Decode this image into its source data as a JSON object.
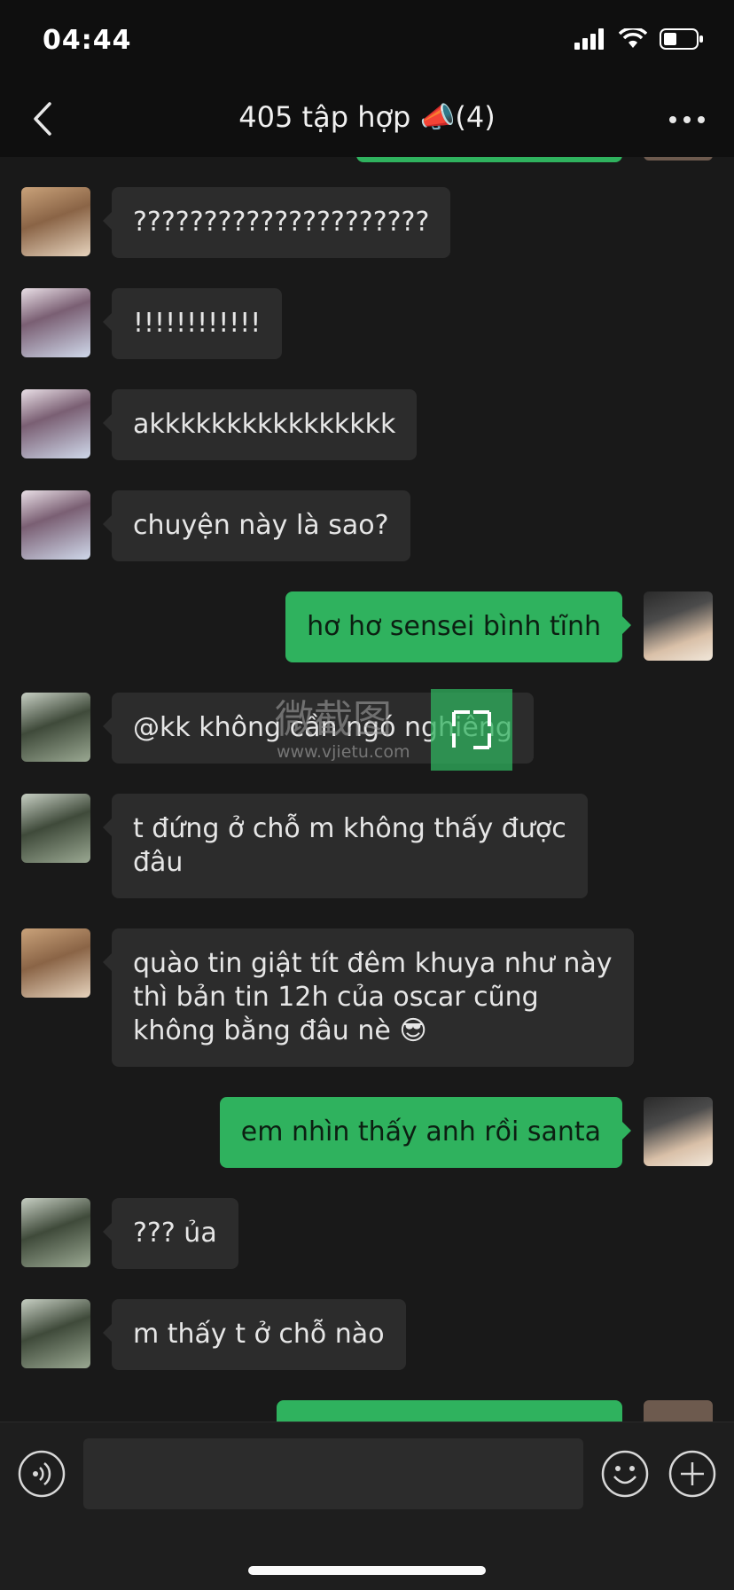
{
  "status": {
    "time": "04:44"
  },
  "header": {
    "title": "405 tập hợp 📣(4)"
  },
  "messages": [
    {
      "side": "in",
      "avatar": "avatar-blond",
      "text": "?????????????????????"
    },
    {
      "side": "in",
      "avatar": "avatar-white-shirt",
      "text": "!!!!!!!!!!!!"
    },
    {
      "side": "in",
      "avatar": "avatar-white-shirt",
      "text": "akkkkkkkkkkkkkkkk"
    },
    {
      "side": "in",
      "avatar": "avatar-white-shirt",
      "text": "chuyện này là sao?"
    },
    {
      "side": "out",
      "avatar": "avatar-beanie",
      "text": "hơ hơ sensei bình tĩnh"
    },
    {
      "side": "in",
      "avatar": "avatar-camo",
      "text": "@kk không cần ngó nghiêng"
    },
    {
      "side": "in",
      "avatar": "avatar-camo",
      "text": "t đứng ở chỗ m không thấy được\nđâu"
    },
    {
      "side": "in",
      "avatar": "avatar-blond",
      "text": "quào tin giật tít đêm khuya như này\nthì bản tin 12h của oscar cũng\nkhông bằng đâu nè 😎"
    },
    {
      "side": "out",
      "avatar": "avatar-beanie",
      "text": "em nhìn thấy anh rồi santa"
    },
    {
      "side": "in",
      "avatar": "avatar-camo",
      "text": "??? ủa"
    },
    {
      "side": "in",
      "avatar": "avatar-camo",
      "text": "m thấy t ở chỗ nào"
    }
  ],
  "watermark": {
    "text": "微截图",
    "url": "www.vjietu.com"
  },
  "input": {
    "placeholder": ""
  },
  "colors": {
    "background": "#191919",
    "incoming_bubble": "#2c2c2c",
    "outgoing_bubble": "#2fb25e",
    "bar": "#0f0f0f"
  }
}
